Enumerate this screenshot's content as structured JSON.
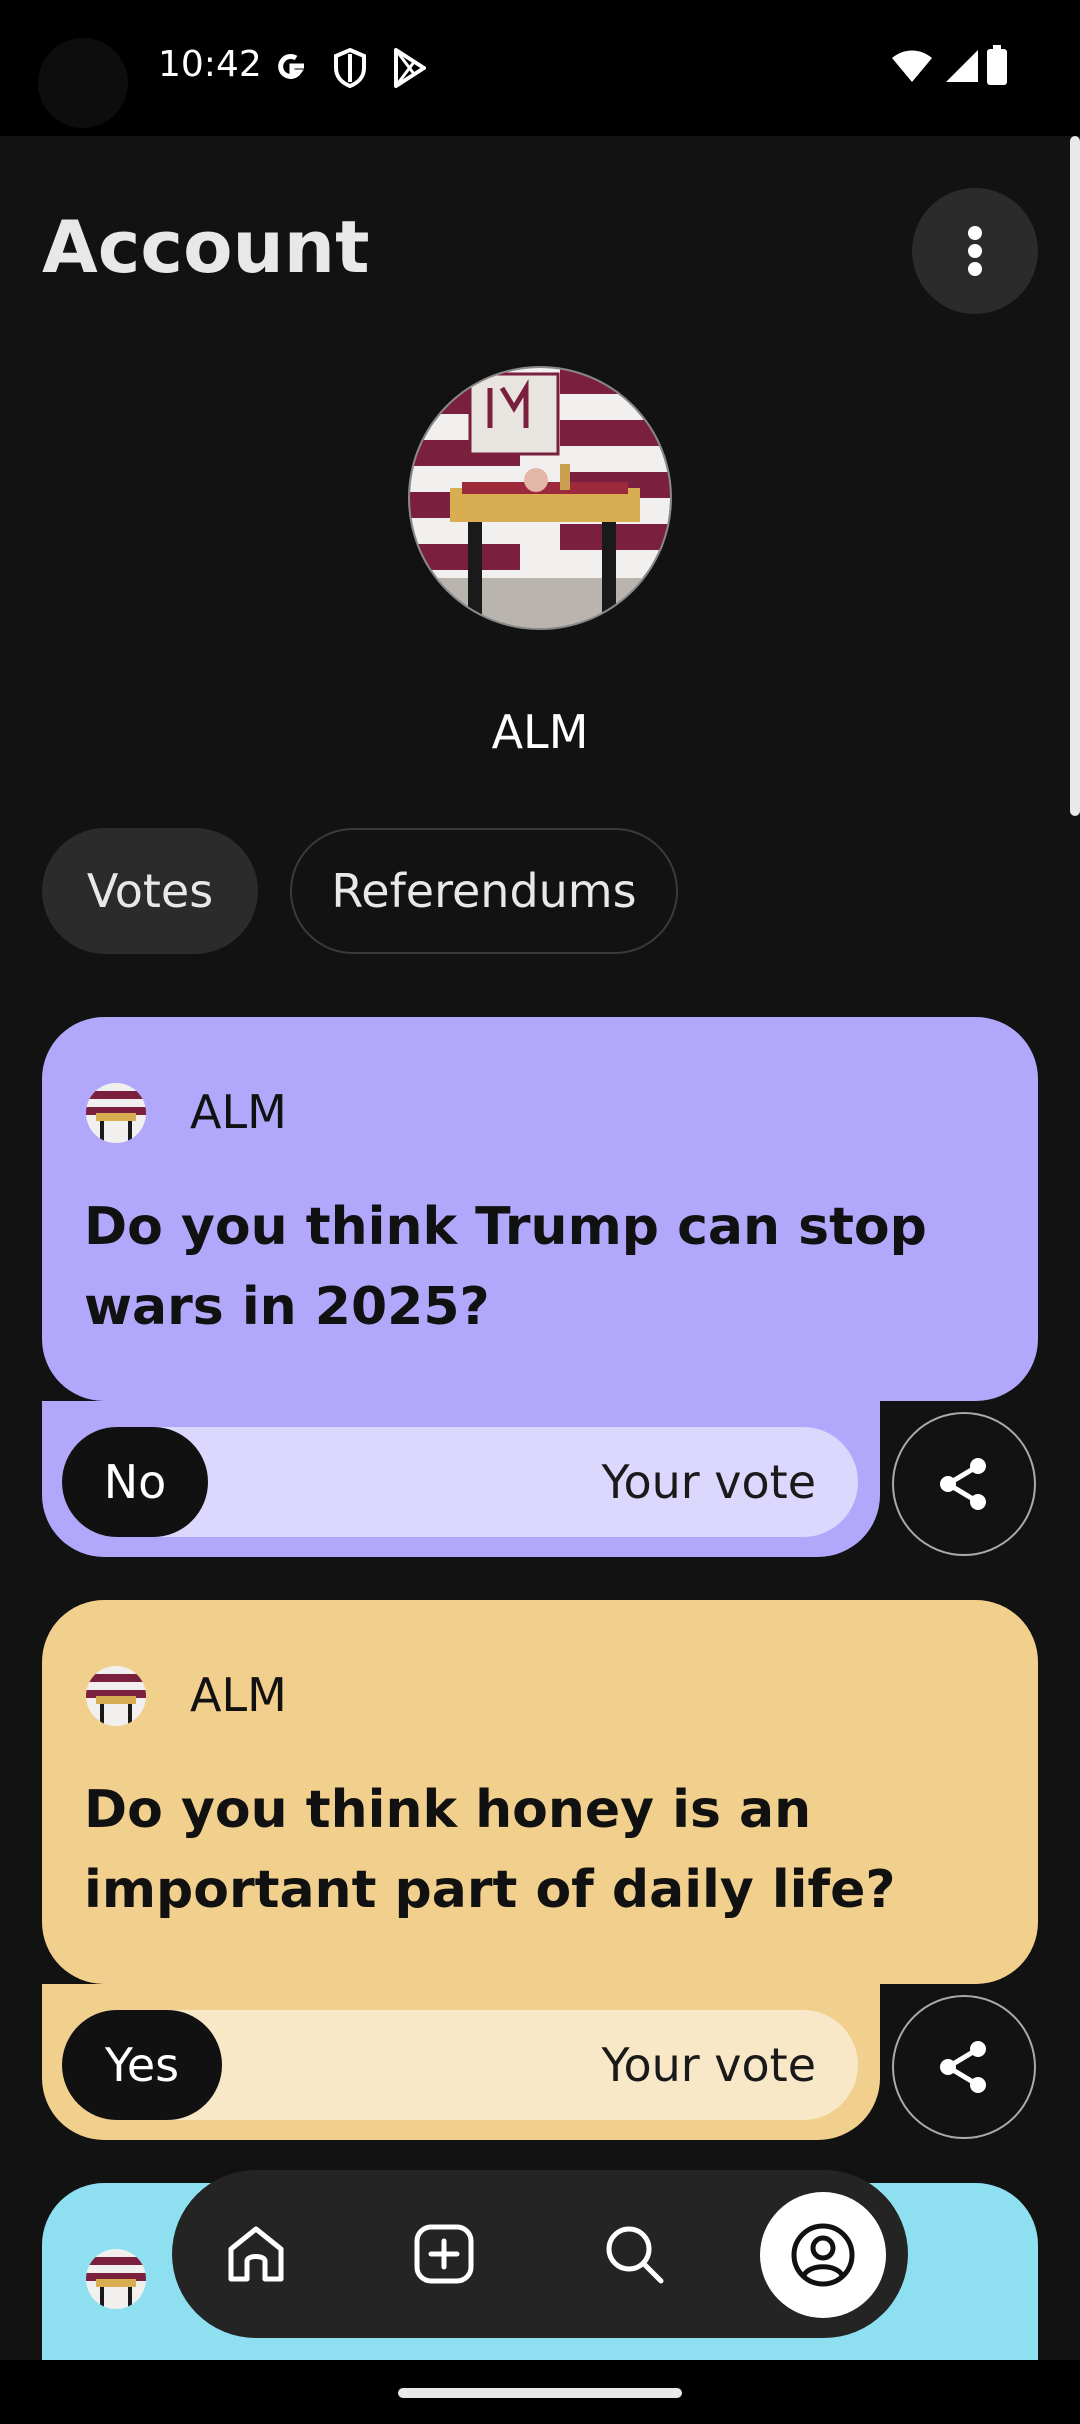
{
  "status_bar": {
    "time": "10:42"
  },
  "header": {
    "title": "Account"
  },
  "profile": {
    "username": "ALM"
  },
  "tabs": [
    {
      "label": "Votes",
      "selected": true
    },
    {
      "label": "Referendums",
      "selected": false
    }
  ],
  "cards": [
    {
      "author": "ALM",
      "question": "Do you think Trump can stop wars in 2025?",
      "vote_choice": "No",
      "vote_label": "Your vote",
      "color": "#b2a8fb",
      "bar_color": "#dcd7fd"
    },
    {
      "author": "ALM",
      "question": "Do you think honey is an important part of daily life?",
      "vote_choice": "Yes",
      "vote_label": "Your vote",
      "color": "#f1cf8c",
      "bar_color": "#f8e8c8"
    },
    {
      "color": "#8ee0f0"
    }
  ],
  "nav": [
    "home-icon",
    "add-icon",
    "search-icon",
    "account-icon"
  ]
}
